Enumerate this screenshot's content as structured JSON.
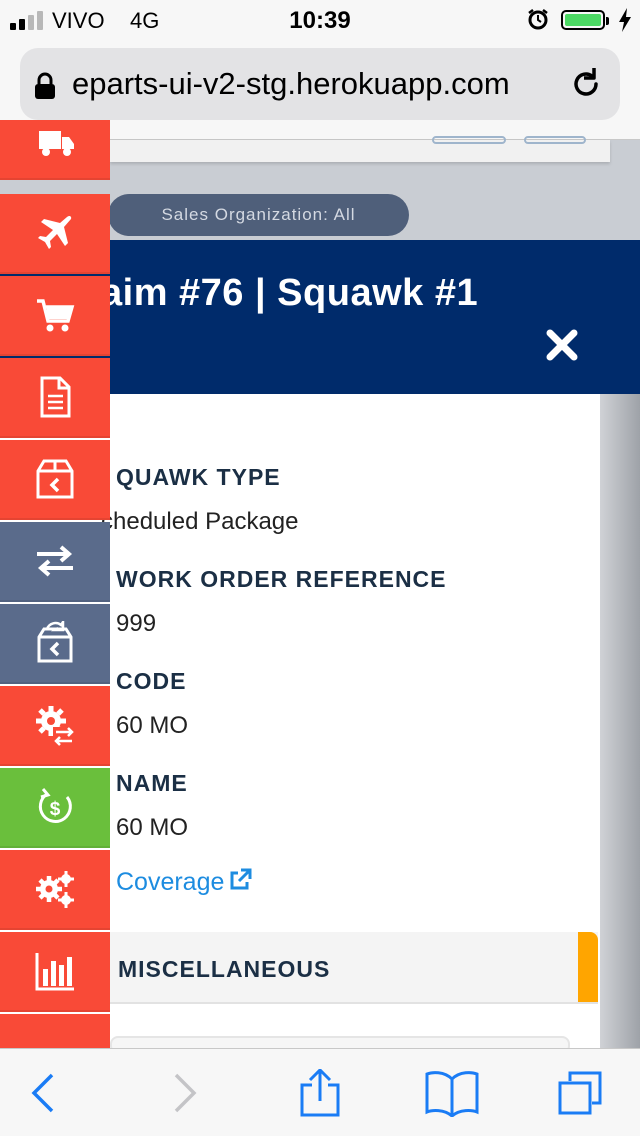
{
  "status_bar": {
    "carrier": "VIVO",
    "network": "4G",
    "time": "10:39",
    "icons": [
      "signal-icon",
      "alarm-icon",
      "battery-icon",
      "charging-icon"
    ],
    "battery_color": "#4cd964"
  },
  "browser": {
    "url": "eparts-ui-v2-stg.herokuapp.com",
    "icons": [
      "lock-icon",
      "reload-icon"
    ]
  },
  "background_page": {
    "sales_org_filter": "Sales Organization: All"
  },
  "sidebar": {
    "items": [
      {
        "icon": "truck-icon",
        "color": "#f94a37"
      },
      {
        "icon": "airplane-icon",
        "color": "#f94a37"
      },
      {
        "icon": "cart-icon",
        "color": "#f94a37"
      },
      {
        "icon": "document-icon",
        "color": "#f94a37"
      },
      {
        "icon": "box-return-icon",
        "color": "#f94a37"
      },
      {
        "icon": "exchange-icon",
        "color": "#5a6b8b"
      },
      {
        "icon": "box-reload-icon",
        "color": "#5a6b8b"
      },
      {
        "icon": "gear-exchange-icon",
        "color": "#f94a37"
      },
      {
        "icon": "dollar-cycle-icon",
        "color": "#6abf3c"
      },
      {
        "icon": "gears-icon",
        "color": "#f94a37"
      },
      {
        "icon": "bar-chart-icon",
        "color": "#f94a37"
      },
      {
        "icon": "more-icon",
        "color": "#f94a37"
      }
    ]
  },
  "modal": {
    "title": "aim #76 | Squawk #1",
    "header_color": "#002b6b",
    "fields": [
      {
        "label": "QUAWK TYPE",
        "value": "cheduled Package"
      },
      {
        "label": "WORK ORDER REFERENCE",
        "value": "999"
      },
      {
        "label": "CODE",
        "value": "60 MO"
      },
      {
        "label": "NAME",
        "value": "60 MO"
      }
    ],
    "coverage_link": "Coverage",
    "section": {
      "label": "MISCELLANEOUS",
      "accent_color": "#ffa500"
    }
  },
  "toolbar": {
    "icons": [
      "back-icon",
      "forward-icon",
      "share-icon",
      "bookmarks-icon",
      "tabs-icon"
    ],
    "tint": "#1a7cf5"
  }
}
